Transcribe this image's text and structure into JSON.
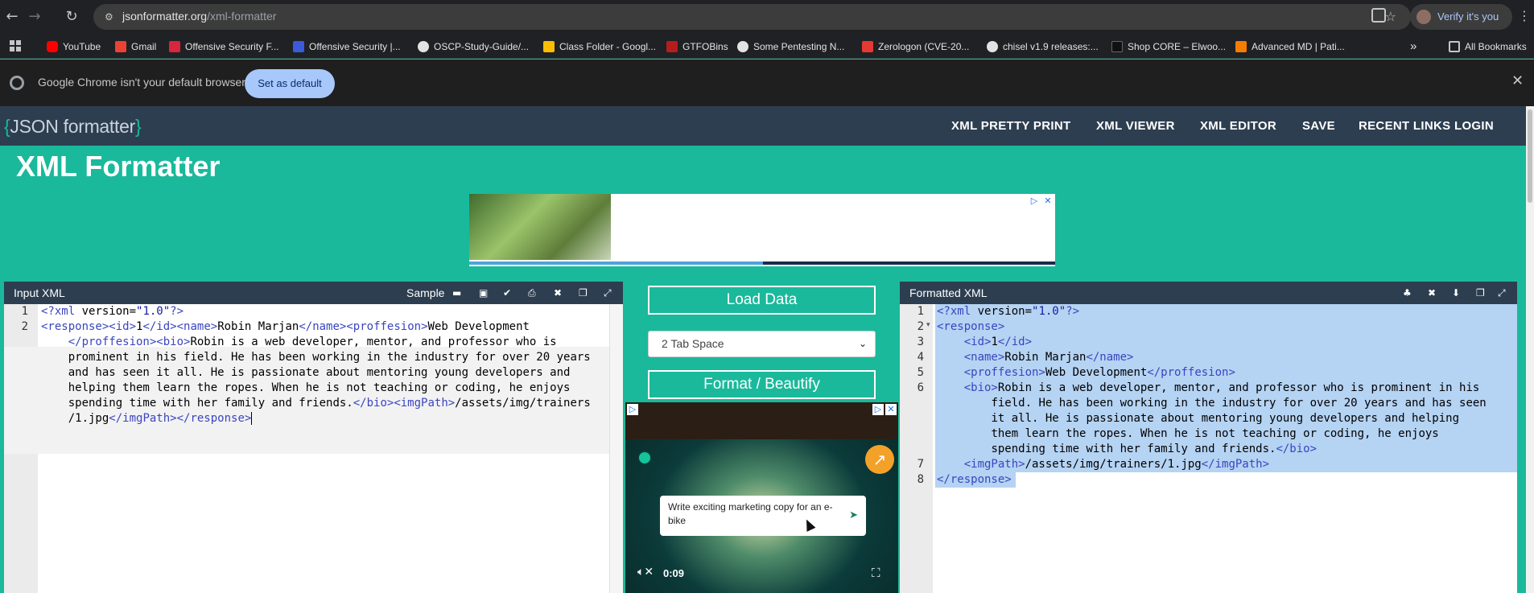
{
  "browser": {
    "url_host": "jsonformatter.org",
    "url_path": "/xml-formatter",
    "verify_label": "Verify it's you",
    "back_icon": "arrow-left-icon",
    "forward_icon": "arrow-right-icon",
    "reload_icon": "reload-icon"
  },
  "bookmarks": {
    "items": [
      {
        "label": "YouTube",
        "color": "#ff0000"
      },
      {
        "label": "Gmail",
        "color": "#ea4335"
      },
      {
        "label": "Offensive Security F...",
        "color": "#d7263d"
      },
      {
        "label": "Offensive Security |...",
        "color": "#3b5bdb"
      },
      {
        "label": "OSCP-Study-Guide/...",
        "color": "#e3e3e3"
      },
      {
        "label": "Class Folder - Googl...",
        "color": "#fbbc04"
      },
      {
        "label": "GTFOBins",
        "color": "#b71c1c"
      },
      {
        "label": "Some Pentesting N...",
        "color": "#e3e3e3"
      },
      {
        "label": "Zerologon (CVE-20...",
        "color": "#e53935"
      },
      {
        "label": "chisel v1.9 releases:...",
        "color": "#e3e3e3"
      },
      {
        "label": "Shop CORE – Elwoo...",
        "color": "#111111"
      },
      {
        "label": "Advanced MD | Pati...",
        "color": "#f57c00"
      }
    ],
    "more": "»",
    "all_bookmarks": "All Bookmarks"
  },
  "infobar": {
    "message": "Google Chrome isn't your default browser",
    "button": "Set as default",
    "close": "✕"
  },
  "site": {
    "logo_open": "{",
    "logo_text": "JSON formatter",
    "logo_close": "}",
    "nav": [
      "XML PRETTY PRINT",
      "XML VIEWER",
      "XML EDITOR",
      "SAVE",
      "RECENT LINKS",
      "LOGIN"
    ],
    "title": "XML Formatter"
  },
  "input_panel": {
    "title": "Input XML",
    "sample_label": "Sample",
    "line_numbers": [
      "1",
      "2"
    ]
  },
  "middle": {
    "load_button": "Load Data",
    "indent_select": "2 Tab Space",
    "format_button": "Format / Beautify"
  },
  "output_panel": {
    "title": "Formatted XML",
    "line_numbers": [
      "1",
      "2",
      "3",
      "4",
      "5",
      "6",
      "",
      "",
      "",
      "",
      "7",
      "8"
    ]
  },
  "xml": {
    "decl_open": "<?",
    "decl_name": "xml",
    "decl_attr": " version=",
    "decl_val": "\"1.0\"",
    "decl_close": "?>",
    "response_open": "<response>",
    "response_close": "</response>",
    "id_open": "<id>",
    "id_val": "1",
    "id_close": "</id>",
    "name_open": "<name>",
    "name_val": "Robin Marjan",
    "name_close": "</name>",
    "prof_open": "<proffesion>",
    "prof_val": "Web Development",
    "prof_close": "</proffesion>",
    "bio_open": "<bio>",
    "bio_close": "</bio>",
    "img_open": "<imgPath>",
    "img_val": "/assets/img/trainers/1.jpg",
    "img_close": "</imgPath>",
    "input_bio_lines": [
      "Robin is a web developer, mentor, and professor who is",
      "prominent in his field. He has been working in the industry for over 20 years",
      "and has seen it all. He is passionate about mentoring young developers and",
      "helping them learn the ropes. When he is not teaching or coding, he enjoys",
      "spending time with her family and friends."
    ],
    "input_img_part1": "/assets/img/trainers",
    "input_img_part2": "/1.jpg",
    "output_bio_lines": [
      "Robin is a web developer, mentor, and professor who is prominent in his",
      "field. He has been working in the industry for over 20 years and has seen",
      "it all. He is passionate about mentoring young developers and helping",
      "them learn the ropes. When he is not teaching or coding, he enjoys",
      "spending time with her family and friends."
    ]
  },
  "video_ad": {
    "prompt": "Write exciting marketing copy for an e-bike",
    "time": "0:09"
  }
}
